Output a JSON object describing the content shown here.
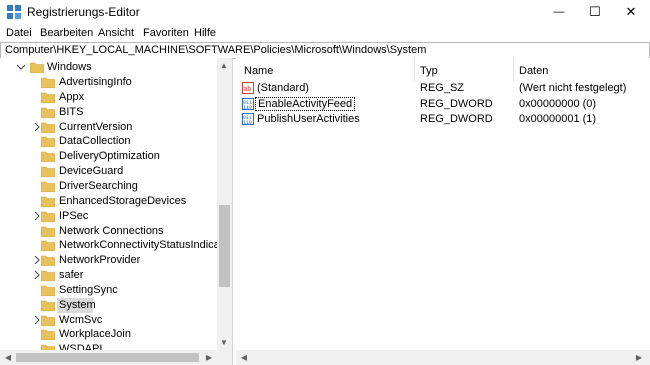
{
  "window": {
    "title": "Registrierungs-Editor",
    "minimize_glyph": "—",
    "maximize_glyph": "☐",
    "close_glyph": "✕"
  },
  "menu": [
    "Datei",
    "Bearbeiten",
    "Ansicht",
    "Favoriten",
    "Hilfe"
  ],
  "address": "Computer\\HKEY_LOCAL_MACHINE\\SOFTWARE\\Policies\\Microsoft\\Windows\\System",
  "tree": {
    "root": "Windows",
    "items": [
      {
        "label": "AdvertisingInfo",
        "expandable": false
      },
      {
        "label": "Appx",
        "expandable": false
      },
      {
        "label": "BITS",
        "expandable": false
      },
      {
        "label": "CurrentVersion",
        "expandable": true
      },
      {
        "label": "DataCollection",
        "expandable": false
      },
      {
        "label": "DeliveryOptimization",
        "expandable": false
      },
      {
        "label": "DeviceGuard",
        "expandable": false
      },
      {
        "label": "DriverSearching",
        "expandable": false
      },
      {
        "label": "EnhancedStorageDevices",
        "expandable": false
      },
      {
        "label": "IPSec",
        "expandable": true
      },
      {
        "label": "Network Connections",
        "expandable": false
      },
      {
        "label": "NetworkConnectivityStatusIndicator",
        "expandable": false
      },
      {
        "label": "NetworkProvider",
        "expandable": true
      },
      {
        "label": "safer",
        "expandable": true
      },
      {
        "label": "SettingSync",
        "expandable": false
      },
      {
        "label": "System",
        "expandable": false,
        "selected": true
      },
      {
        "label": "WcmSvc",
        "expandable": true
      },
      {
        "label": "WorkplaceJoin",
        "expandable": false
      },
      {
        "label": "WSDAPI",
        "expandable": false
      }
    ]
  },
  "values": {
    "columns": {
      "name": "Name",
      "type": "Typ",
      "data": "Daten"
    },
    "rows": [
      {
        "name": "(Standard)",
        "type": "REG_SZ",
        "data": "(Wert nicht festgelegt)",
        "icon": "string-value-icon"
      },
      {
        "name": "EnableActivityFeed",
        "type": "REG_DWORD",
        "data": "0x00000000 (0)",
        "icon": "dword-value-icon",
        "focused": true
      },
      {
        "name": "PublishUserActivities",
        "type": "REG_DWORD",
        "data": "0x00000001 (1)",
        "icon": "dword-value-icon"
      }
    ]
  },
  "colors": {
    "folder": "#e8c15c",
    "selected_row": "#d9d9d9",
    "scrollbar": "#f0f0f0"
  }
}
